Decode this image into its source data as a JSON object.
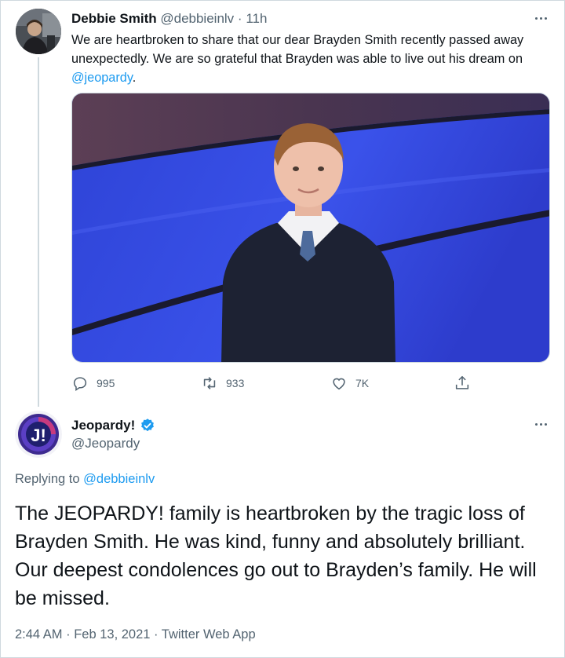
{
  "tweet1": {
    "author_name": "Debbie Smith",
    "handle": "@debbieinlv",
    "separator": "·",
    "time": "11h",
    "text_before_link": "We are heartbroken to share that our dear Brayden Smith recently passed away unexpectedly. We are so grateful that Brayden was able to live out his dream on ",
    "mention": "@jeopardy",
    "text_after_link": ".",
    "stats": {
      "replies": "995",
      "retweets": "933",
      "likes": "7K"
    },
    "icons": [
      "reply-icon",
      "retweet-icon",
      "like-icon",
      "share-icon",
      "more-icon"
    ]
  },
  "tweet2": {
    "author_name": "Jeopardy!",
    "handle": "@Jeopardy",
    "replying_prefix": "Replying to ",
    "replying_to": "@debbieinlv",
    "text": "The JEOPARDY! family is heartbroken by the tragic loss of Brayden Smith. He was kind, funny and absolutely brilliant. Our deepest condolences go out to Brayden’s family. He will be missed.",
    "timestamp": "2:44 AM · Feb 13, 2021 · Twitter Web App",
    "avatar_letter": "J!",
    "icons": [
      "verified-badge-icon",
      "more-icon"
    ]
  },
  "colors": {
    "link": "#1d9bf0",
    "secondary_text": "#536471",
    "verified": "#1d9bf0",
    "stage_blue": "#3248e0",
    "jeopardy_purple": "#5b2a86"
  }
}
